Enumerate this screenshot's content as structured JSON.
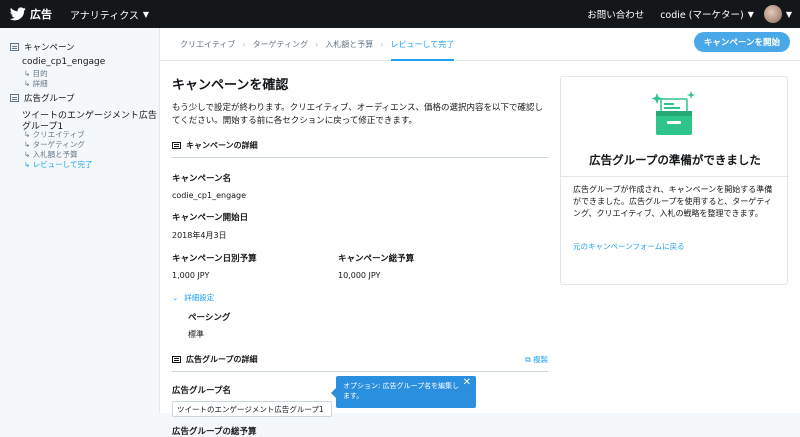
{
  "topbar": {
    "brand": "広告",
    "analytics": "アナリティクス",
    "contact": "お問い合わせ",
    "user": "codie (マーケター)"
  },
  "sidebar": {
    "campaign_section": "キャンペーン",
    "campaign_name": "codie_cp1_engage",
    "campaign_items": [
      "↳ 目的",
      "↳ 詳細"
    ],
    "adgroup_section": "広告グループ",
    "adgroup_name_line1": "ツイートのエンゲージメント広告",
    "adgroup_name_line2": "グループ1",
    "adgroup_items": [
      "↳ クリエイティブ",
      "↳ ターゲティング",
      "↳ 入札額と予算",
      "↳ レビューして完了"
    ]
  },
  "breadcrumbs": [
    "クリエイティブ",
    "ターゲティング",
    "入札額と予算",
    "レビューして完了"
  ],
  "start_button": "キャンペーンを開始",
  "main": {
    "title": "キャンペーンを確認",
    "description": "もう少しで設定が終わります。クリエイティブ、オーディエンス、価格の選択内容を以下で確認してください。開始する前に各セクションに戻って修正できます。",
    "campaign_details_heading": "キャンペーンの詳細",
    "campaign_name_label": "キャンペーン名",
    "campaign_name_value": "codie_cp1_engage",
    "start_date_label": "キャンペーン開始日",
    "start_date_value": "2018年4月3日",
    "daily_budget_label": "キャンペーン日別予算",
    "daily_budget_value": "1,000 JPY",
    "total_budget_label": "キャンペーン総予算",
    "total_budget_value": "10,000 JPY",
    "advanced_settings": "詳細設定",
    "pacing_label": "ペーシング",
    "pacing_value": "標準",
    "adgroup_details_heading": "広告グループの詳細",
    "copy_link": "複製",
    "adgroup_name_label": "広告グループ名",
    "adgroup_name_value": "ツイートのエンゲージメント広告グループ1",
    "adgroup_total_budget_label": "広告グループの総予算",
    "tooltip": "オプション: 広告グループ名を編集します。"
  },
  "card": {
    "title": "広告グループの準備ができました",
    "description": "広告グループが作成され、キャンペーンを開始する準備ができました。広告グループを使用すると、ターゲティング、クリエイティブ、入札の戦略を整理できます。",
    "link": "元のキャンペーンフォームに戻る"
  },
  "colors": {
    "accent": "#1da1f2",
    "topbar": "#14171a",
    "illustration": "#2fc48a"
  }
}
